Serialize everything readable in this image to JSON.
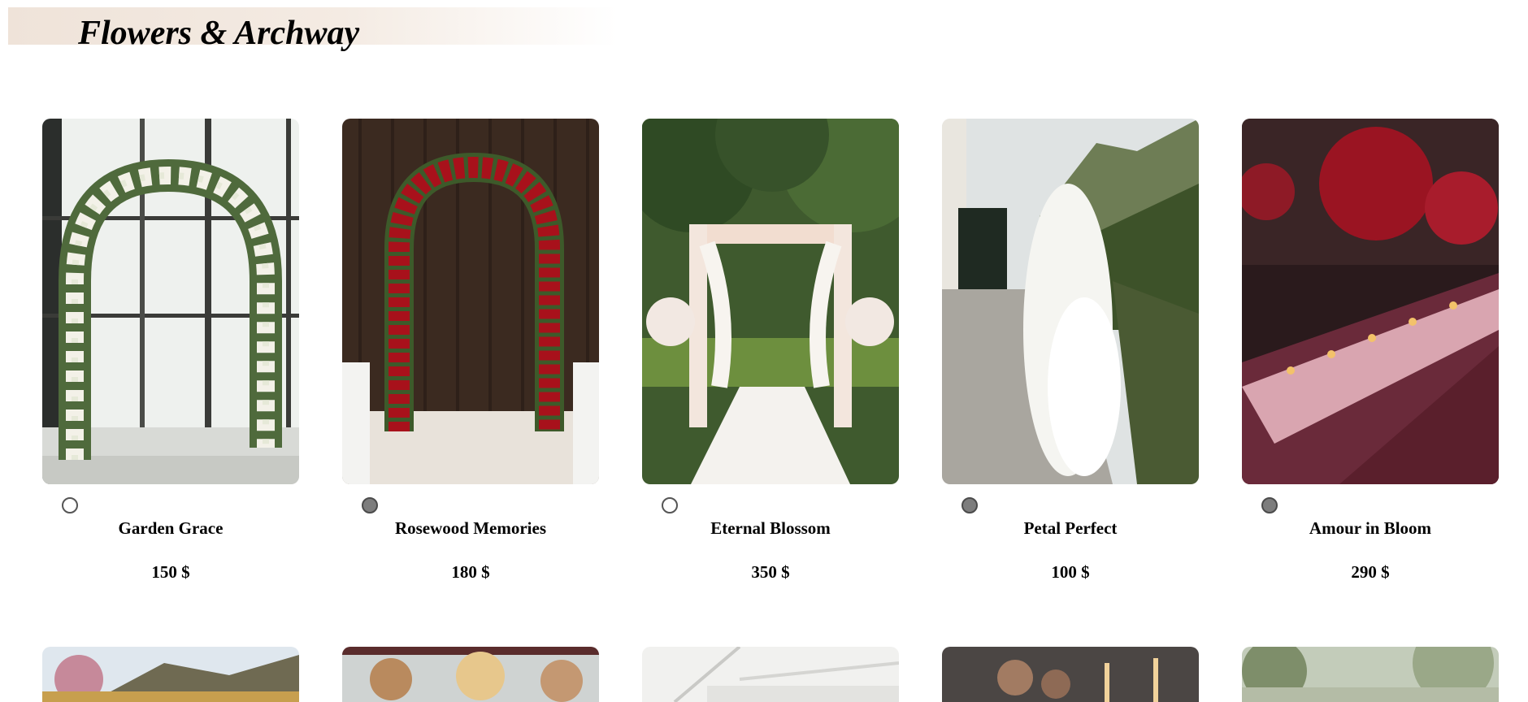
{
  "header": {
    "title": "Flowers & Archway",
    "band_color": "#efe3d9"
  },
  "products": [
    {
      "name": "Garden Grace",
      "price": "150 $",
      "selected": false,
      "image": "white-green-floral-arch-by-window"
    },
    {
      "name": "Rosewood Memories",
      "price": "180 $",
      "selected": true,
      "image": "red-rose-arch-wood-wall"
    },
    {
      "name": "Eternal Blossom",
      "price": "350 $",
      "selected": false,
      "image": "draped-floral-arch-garden-aisle"
    },
    {
      "name": "Petal Perfect",
      "price": "100 $",
      "selected": true,
      "image": "white-hydrangea-arch-mountain-view"
    },
    {
      "name": "Amour in Bloom",
      "price": "290 $",
      "selected": true,
      "image": "red-floral-banquet-table"
    }
  ],
  "second_row": [
    {
      "image": "floral-arrangement-mountains"
    },
    {
      "image": "crystal-chandelier-tent"
    },
    {
      "image": "white-canopy-frame"
    },
    {
      "image": "candlelit-table-desserts"
    },
    {
      "image": "greenery-soft-focus"
    }
  ]
}
